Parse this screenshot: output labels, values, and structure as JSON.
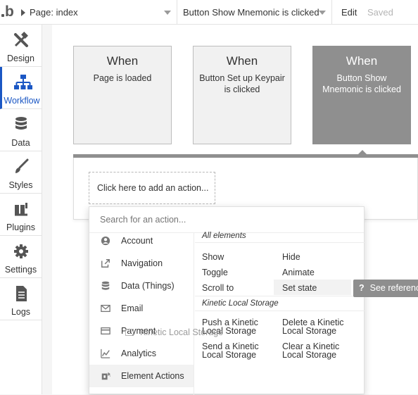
{
  "topbar": {
    "page_dropdown": "Page: index",
    "event_dropdown": "Button Show Mnemonic is clicked",
    "edit_label": "Edit",
    "saved_label": "Saved"
  },
  "sidebar": {
    "items": [
      {
        "label": "Design",
        "icon": "design-icon"
      },
      {
        "label": "Workflow",
        "icon": "workflow-icon",
        "active": true
      },
      {
        "label": "Data",
        "icon": "data-icon"
      },
      {
        "label": "Styles",
        "icon": "brush-icon"
      },
      {
        "label": "Plugins",
        "icon": "plug-icon"
      },
      {
        "label": "Settings",
        "icon": "gear-icon"
      },
      {
        "label": "Logs",
        "icon": "document-icon"
      }
    ]
  },
  "events": [
    {
      "when": "When",
      "desc": "Page is loaded"
    },
    {
      "when": "When",
      "desc": "Button Set up Keypair is clicked"
    },
    {
      "when": "When",
      "desc": "Button Show Mnemonic is clicked",
      "selected": true
    }
  ],
  "add_action_label": "Click here to add an action...",
  "action_popup": {
    "search_placeholder": "Search for an action...",
    "categories": [
      {
        "label": "Account",
        "icon": "account-icon"
      },
      {
        "label": "Navigation",
        "icon": "navigation-icon"
      },
      {
        "label": "Data (Things)",
        "icon": "database-icon"
      },
      {
        "label": "Email",
        "icon": "email-icon"
      },
      {
        "label": "Payment",
        "icon": "payment-icon"
      },
      {
        "label": "Analytics",
        "icon": "analytics-icon"
      },
      {
        "label": "Element Actions",
        "icon": "element-actions-icon",
        "active": true
      }
    ],
    "all_elements_header": "All elements",
    "all_elements_options": [
      "Show",
      "Hide",
      "Toggle",
      "Animate",
      "Scroll to",
      "Set state"
    ],
    "plugin_header": "Kinetic Local Storage",
    "plugin_options": [
      "Push a Kinetic Local Storage",
      "Delete a Kinetic Local Storage",
      "Send a Kinetic Local Storage",
      "Clear a Kinetic Local Storage"
    ]
  },
  "drag_ghost_label": "Kinetic Local Storage",
  "see_reference_label": "See reference",
  "colors": {
    "accent": "#1b57c4",
    "selected_card": "#8f8f8f",
    "tooltip": "#8e8e8e"
  }
}
